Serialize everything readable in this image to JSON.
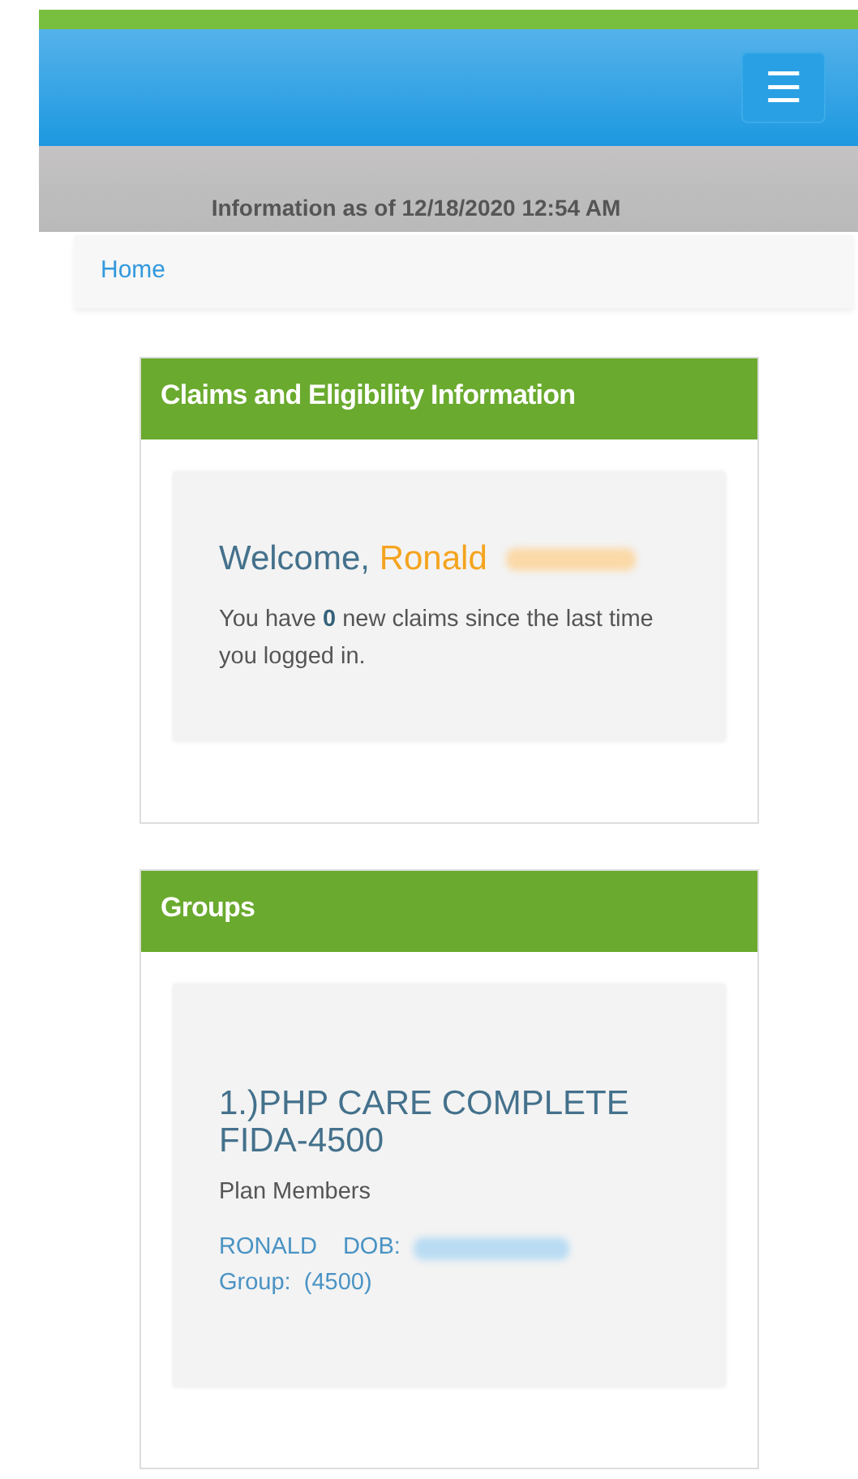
{
  "header": {
    "menu_button": "☰"
  },
  "info_bar": {
    "text": "Information as of 12/18/2020 12:54 AM"
  },
  "breadcrumb": [
    {
      "label": "Home"
    }
  ],
  "panels": [
    {
      "kind": "welcome",
      "title": "Claims and Eligibility Information",
      "greeting": "Welcome,",
      "name": "Ronald",
      "message": "You have **0** new claims since the last time you logged in."
    },
    {
      "kind": "groups",
      "title": "Groups",
      "groups": [
        {
          "name": "1.)PHP CARE COMPLETE FIDA-4500",
          "subtitle": "Plan Members",
          "member": "RONALD",
          "dob_label": "DOB:",
          "group": "Group:  (4500)"
        }
      ]
    }
  ]
}
